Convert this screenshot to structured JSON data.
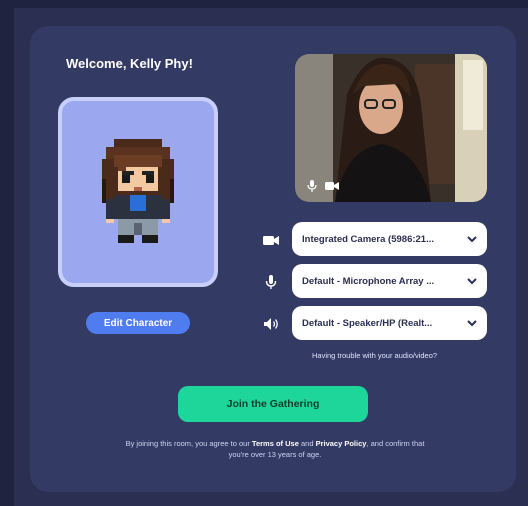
{
  "welcome": {
    "title": "Welcome, Kelly Phy!"
  },
  "character": {
    "edit_label": "Edit Character"
  },
  "preview": {
    "icons": [
      "microphone-icon",
      "camera-icon"
    ]
  },
  "devices": {
    "camera": {
      "icon": "camera-icon",
      "value": "Integrated Camera (5986:21..."
    },
    "microphone": {
      "icon": "microphone-icon",
      "value": "Default - Microphone Array ..."
    },
    "speaker": {
      "icon": "speaker-icon",
      "value": "Default - Speaker/HP (Realt..."
    }
  },
  "help": {
    "trouble_link": "Having trouble with your audio/video?"
  },
  "join": {
    "label": "Join the Gathering"
  },
  "legal": {
    "prefix": "By joining this room, you agree to our ",
    "terms": "Terms of Use",
    "and": " and ",
    "privacy": "Privacy Policy",
    "suffix": ", and confirm that you're over 13 years of age."
  },
  "colors": {
    "background": "#2b2f52",
    "card": "#333a63",
    "avatar_bg": "#9ba8f0",
    "edit_button": "#4f7df0",
    "join_button": "#1fd69a"
  }
}
